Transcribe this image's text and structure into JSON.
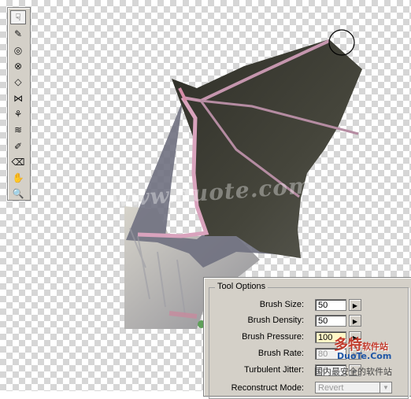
{
  "toolbar": {
    "tools": [
      {
        "name": "forward-warp-tool",
        "glyph": "☟",
        "selected": true
      },
      {
        "name": "reconstruct-tool",
        "glyph": "✎",
        "selected": false
      },
      {
        "name": "twirl-clockwise-tool",
        "glyph": "◎",
        "selected": false
      },
      {
        "name": "pucker-tool",
        "glyph": "⊗",
        "selected": false
      },
      {
        "name": "bloat-tool",
        "glyph": "◇",
        "selected": false
      },
      {
        "name": "push-left-tool",
        "glyph": "⋈",
        "selected": false
      },
      {
        "name": "mirror-tool",
        "glyph": "⚘",
        "selected": false
      },
      {
        "name": "turbulence-tool",
        "glyph": "≋",
        "selected": false
      },
      {
        "name": "freeze-mask-tool",
        "glyph": "✐",
        "selected": false
      },
      {
        "name": "thaw-mask-tool",
        "glyph": "⌫",
        "selected": false
      },
      {
        "name": "hand-tool",
        "glyph": "✋",
        "selected": false
      },
      {
        "name": "zoom-tool",
        "glyph": "🔍",
        "selected": false
      }
    ]
  },
  "tool_options": {
    "title": "Tool Options",
    "brush_size_label": "Brush Size:",
    "brush_size_value": "50",
    "brush_density_label": "Brush Density:",
    "brush_density_value": "50",
    "brush_pressure_label": "Brush Pressure:",
    "brush_pressure_value": "100",
    "brush_rate_label": "Brush Rate:",
    "brush_rate_value": "80",
    "turbulent_jitter_label": "Turbulent Jitter:",
    "turbulent_jitter_value": "50",
    "reconstruct_mode_label": "Reconstruct Mode:",
    "reconstruct_mode_value": "Revert"
  },
  "watermark": {
    "text": "www.duote.com"
  },
  "logo": {
    "brand": "多特",
    "brand_suffix": "软件站",
    "domain": "DuoTe.Com",
    "tagline": "国内最安全的软件站"
  },
  "colors": {
    "wing": "#3b3b33",
    "bone": "#c9a0b4",
    "fur": "#c9c6bd",
    "panel": "#d4d0c8"
  }
}
